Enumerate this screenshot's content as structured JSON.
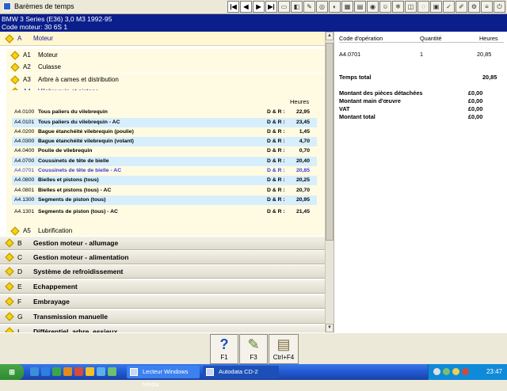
{
  "window": {
    "title": "Barèmes de temps"
  },
  "header": {
    "vehicle": "BMW   3 Series (E36) 3,0 M3 1992-95",
    "engine_code": "Code moteur: 30 6S 1"
  },
  "tree": {
    "group_a": {
      "letter": "A",
      "label": "Moteur"
    },
    "subsections": [
      {
        "code": "A1",
        "label": "Moteur"
      },
      {
        "code": "A2",
        "label": "Culasse"
      },
      {
        "code": "A3",
        "label": "Arbre à cames et distribution"
      },
      {
        "code": "A4",
        "label": "Vilebrequin et pistons"
      }
    ],
    "subsection_a5": {
      "code": "A5",
      "label": "Lubrification"
    },
    "hours_header": "Heures",
    "operations": [
      {
        "code": "A4.0100",
        "desc": "Tous paliers du vilebrequin",
        "dr": "D & R :",
        "hours": "22,95"
      },
      {
        "code": "A4.0101",
        "desc": "Tous paliers du vilebrequin - AC",
        "dr": "D & R :",
        "hours": "23,45"
      },
      {
        "code": "A4.0200",
        "desc": "Bague étanchéité vilebrequin (poulie)",
        "dr": "D & R :",
        "hours": "1,45"
      },
      {
        "code": "A4.0300",
        "desc": "Bague étanchéité vilebrequin (volant)",
        "dr": "D & R :",
        "hours": "4,70"
      },
      {
        "code": "A4.0400",
        "desc": "Poulie de vilebrequin",
        "dr": "D & R :",
        "hours": "0,70"
      },
      {
        "code": "A4.0700",
        "desc": "Coussinets de tête de bielle",
        "dr": "D & R :",
        "hours": "20,40"
      },
      {
        "code": "A4.0701",
        "desc": "Coussinets de tête de bielle - AC",
        "dr": "D & R :",
        "hours": "20,85"
      },
      {
        "code": "A4.0800",
        "desc": "Bielles et pistons (tous)",
        "dr": "D & R :",
        "hours": "20,25"
      },
      {
        "code": "A4.0801",
        "desc": "Bielles et pistons (tous) - AC",
        "dr": "D & R :",
        "hours": "20,70"
      },
      {
        "code": "A4.1300",
        "desc": "Segments de piston (tous)",
        "dr": "D & R :",
        "hours": "20,95"
      },
      {
        "code": "A4.1301",
        "desc": "Segments de piston (tous) - AC",
        "dr": "D & R :",
        "hours": "21,45"
      }
    ],
    "groups": [
      {
        "letter": "B",
        "label": "Gestion moteur - allumage"
      },
      {
        "letter": "C",
        "label": "Gestion moteur - alimentation"
      },
      {
        "letter": "D",
        "label": "Système de refroidissement"
      },
      {
        "letter": "E",
        "label": "Echappement"
      },
      {
        "letter": "F",
        "label": "Embrayage"
      },
      {
        "letter": "G",
        "label": "Transmission manuelle"
      },
      {
        "letter": "I",
        "label": "Différentiel, arbre, essieux"
      }
    ]
  },
  "summary": {
    "col_code": "Code d'opération",
    "col_qty": "Quantité",
    "col_hours": "Heures",
    "row_code": "A4.0701",
    "row_qty": "1",
    "row_hours": "20,85",
    "total_label": "Temps total",
    "total_value": "20,85",
    "costs": [
      {
        "label": "Montant des pièces détachées",
        "value": "£0,00"
      },
      {
        "label": "Montant main d'œuvre",
        "value": "£0,00"
      },
      {
        "label": "VAT",
        "value": "£0,00"
      },
      {
        "label": "Montant total",
        "value": "£0,00"
      }
    ]
  },
  "function_keys": [
    {
      "label": "F1",
      "icon": "help-icon"
    },
    {
      "label": "F3",
      "icon": "notepad-icon"
    },
    {
      "label": "Ctrl+F4",
      "icon": "document-icon"
    }
  ],
  "taskbar": {
    "start_label": "démarrer",
    "tasks": [
      {
        "label": "Lecteur Windows Media"
      },
      {
        "label": "Autodata CD-2"
      }
    ],
    "clock": "23:47"
  }
}
